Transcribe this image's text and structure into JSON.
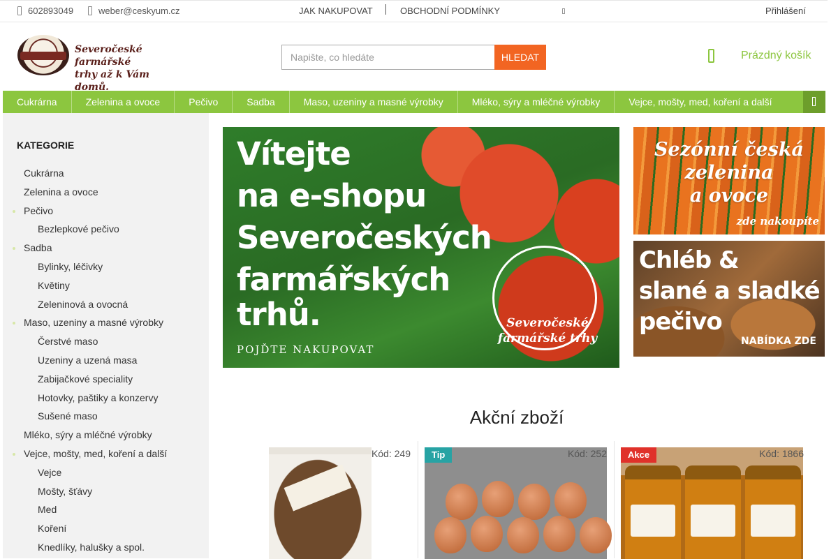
{
  "topbar": {
    "phone": "602893049",
    "email": "weber@ceskyum.cz",
    "links": [
      "JAK NAKUPOVAT",
      "OBCHODNÍ PODMÍNKY"
    ],
    "login": "Přihlášení"
  },
  "header": {
    "logo_line1": "Severočeské farmářské",
    "logo_line2": "trhy až k Vám domů.",
    "logo_tag": "farmářské trhy",
    "search_placeholder": "Napište, co hledáte",
    "search_button": "HLEDAT",
    "cart_label": "Prázdný košík"
  },
  "nav": {
    "items": [
      "Cukrárna",
      "Zelenina a ovoce",
      "Pečivo",
      "Sadba",
      "Maso, uzeniny a masné výrobky",
      "Mléko, sýry a mléčné výrobky",
      "Vejce, mošty, med, koření a další"
    ]
  },
  "sidebar": {
    "title": "KATEGORIE",
    "items": [
      {
        "label": "Cukrárna",
        "level": 0,
        "bullet": false
      },
      {
        "label": "Zelenina a ovoce",
        "level": 0,
        "bullet": false
      },
      {
        "label": "Pečivo",
        "level": 0,
        "bullet": true
      },
      {
        "label": "Bezlepkové pečivo",
        "level": 1,
        "bullet": false
      },
      {
        "label": "Sadba",
        "level": 0,
        "bullet": true
      },
      {
        "label": "Bylinky, léčivky",
        "level": 1,
        "bullet": false
      },
      {
        "label": "Květiny",
        "level": 1,
        "bullet": false
      },
      {
        "label": "Zeleninová a ovocná",
        "level": 1,
        "bullet": false
      },
      {
        "label": "Maso, uzeniny a masné výrobky",
        "level": 0,
        "bullet": true
      },
      {
        "label": "Čerstvé maso",
        "level": 1,
        "bullet": false
      },
      {
        "label": "Uzeniny a uzená masa",
        "level": 1,
        "bullet": false
      },
      {
        "label": "Zabijačkové speciality",
        "level": 1,
        "bullet": false
      },
      {
        "label": "Hotovky, paštiky a konzervy",
        "level": 1,
        "bullet": false
      },
      {
        "label": "Sušené maso",
        "level": 1,
        "bullet": false
      },
      {
        "label": "Mléko, sýry a mléčné výrobky",
        "level": 0,
        "bullet": false
      },
      {
        "label": "Vejce, mošty, med, koření a další",
        "level": 0,
        "bullet": true
      },
      {
        "label": "Vejce",
        "level": 1,
        "bullet": false
      },
      {
        "label": "Mošty, šťávy",
        "level": 1,
        "bullet": false
      },
      {
        "label": "Med",
        "level": 1,
        "bullet": false
      },
      {
        "label": "Koření",
        "level": 1,
        "bullet": false
      },
      {
        "label": "Knedlíky, halušky a spol.",
        "level": 1,
        "bullet": false
      }
    ]
  },
  "banners": {
    "main_lines": [
      "Vítejte",
      "na e-shopu",
      "Severočeských",
      "farmářských",
      "trhů."
    ],
    "main_cta": "POJĎTE NAKUPOVAT",
    "main_seal_line1": "Severočeské",
    "main_seal_line2": "farmářské trhy",
    "side1_lines": [
      "Sezónní česká",
      "zelenina",
      "a ovoce"
    ],
    "side1_cta": "zde nakoupíte",
    "side2_lines": [
      "Chléb &",
      "slané a sladké",
      "pečivo"
    ],
    "side2_cta": "NABÍDKA ZDE"
  },
  "products": {
    "title": "Akční zboží",
    "items": [
      {
        "code": "Kód: 249",
        "badge": ""
      },
      {
        "code": "Kód: 252",
        "badge": "Tip"
      },
      {
        "code": "Kód: 1866",
        "badge": "Akce"
      }
    ]
  },
  "colors": {
    "accent_green": "#8cc63f",
    "search_button": "#f26522",
    "badge_tip": "#27a3a4",
    "badge_akce": "#e0312a"
  }
}
